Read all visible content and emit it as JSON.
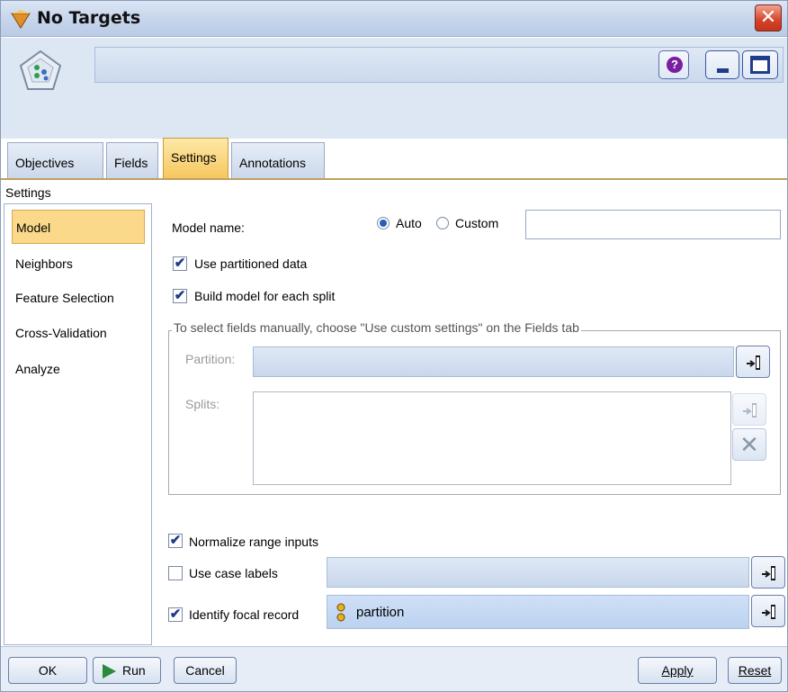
{
  "window": {
    "title": "No Targets",
    "close_label": "✕"
  },
  "tabs": [
    {
      "label": "Objectives"
    },
    {
      "label": "Fields"
    },
    {
      "label": "Settings"
    },
    {
      "label": "Annotations"
    }
  ],
  "section_title": "Settings",
  "sidebar": {
    "items": [
      {
        "label": "Model",
        "selected": true
      },
      {
        "label": "Neighbors"
      },
      {
        "label": "Feature Selection"
      },
      {
        "label": "Cross-Validation"
      },
      {
        "label": "Analyze"
      }
    ]
  },
  "model": {
    "name_label": "Model name:",
    "auto_label": "Auto",
    "custom_label": "Custom",
    "selected_mode": "Auto",
    "custom_value": "",
    "use_partitioned": {
      "label": "Use partitioned data",
      "checked": true
    },
    "build_each_split": {
      "label": "Build model for each split",
      "checked": true
    }
  },
  "fields_group": {
    "title": "To select fields manually, choose \"Use custom settings\" on the Fields tab",
    "partition_label": "Partition:",
    "partition_value": "",
    "splits_label": "Splits:"
  },
  "options": {
    "normalize": {
      "label": "Normalize range inputs",
      "checked": true
    },
    "case_labels": {
      "label": "Use case labels",
      "checked": false,
      "value": ""
    },
    "focal_record": {
      "label": "Identify focal record",
      "checked": true,
      "value": "partition"
    }
  },
  "buttons": {
    "ok": "OK",
    "run": "Run",
    "cancel": "Cancel",
    "apply": "Apply",
    "reset": "Reset"
  },
  "colors": {
    "active_tab": "#f6c65d",
    "selected_item": "#fbd98a",
    "accent": "#1f3d8a"
  }
}
